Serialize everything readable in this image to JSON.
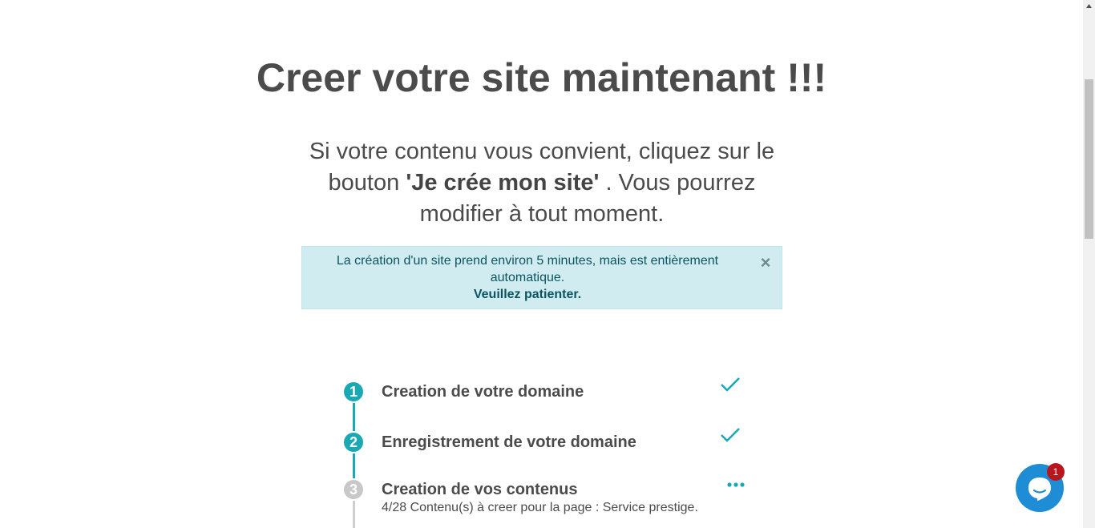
{
  "header": {
    "title": "Creer votre site maintenant !!!"
  },
  "intro": {
    "text_before": "Si votre contenu vous convient, cliquez sur le bouton ",
    "button_name": "'Je crée mon site'",
    "text_after": " . Vous pourrez modifier à tout moment."
  },
  "alert": {
    "message": "La création d'un site prend environ 5 minutes, mais est entièrement automatique.",
    "emphasis": "Veuillez patienter.",
    "close_symbol": "×"
  },
  "steps": [
    {
      "number": "1",
      "label": "Creation de votre domaine",
      "status": "done",
      "status_icon": "check-icon"
    },
    {
      "number": "2",
      "label": "Enregistrement de votre domaine",
      "status": "done",
      "status_icon": "check-icon"
    },
    {
      "number": "3",
      "label": "Creation de vos contenus",
      "status": "in-progress",
      "status_icon": "more-dots-icon",
      "detail": "4/28 Contenu(s) à creer pour la page : Service prestige."
    }
  ],
  "chat": {
    "icon": "chat-bubble-icon",
    "badge_count": "1"
  },
  "colors": {
    "accent": "#1aa8b5",
    "alert_bg": "#d1ecf1",
    "alert_text": "#0c5460",
    "pending": "#c8c8c8",
    "chat": "#1f8dd6",
    "badge": "#b8151d"
  }
}
